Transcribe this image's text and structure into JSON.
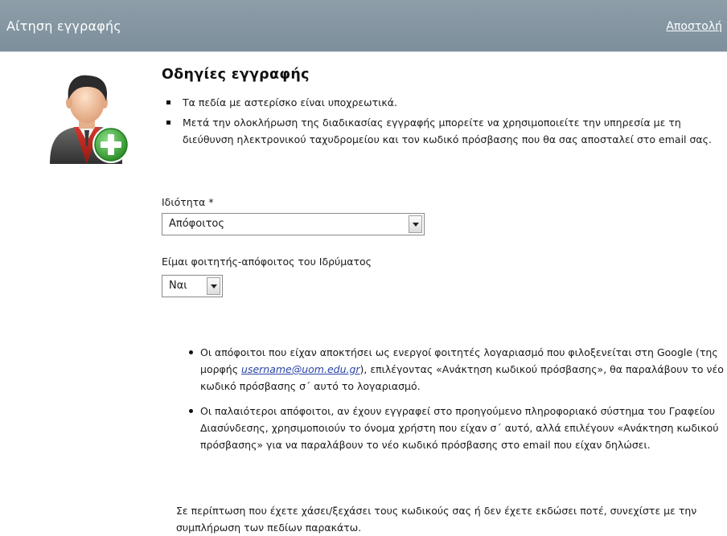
{
  "header": {
    "title": "Αίτηση εγγραφής",
    "send_label": "Αποστολή"
  },
  "avatar": {
    "icon": "user-add-icon"
  },
  "instructions": {
    "heading": "Οδηγίες εγγραφής",
    "items": [
      "Τα πεδία με αστερίσκο είναι υποχρεωτικά.",
      "Μετά την ολοκλήρωση της διαδικασίας εγγραφής μπορείτε να χρησιμοποιείτε την υπηρεσία με τη διεύθυνση ηλεκτρονικού ταχυδρομείου και τον κωδικό πρόσβασης που θα σας αποσταλεί στο email σας."
    ]
  },
  "form": {
    "property": {
      "label": "Ιδιότητα *",
      "value": "Απόφοιτος"
    },
    "student": {
      "label": "Είμαι φοιτητής-απόφοιτος του Ιδρύματος",
      "value": "Ναι"
    }
  },
  "info": {
    "bullet1_pre": "Οι απόφοιτοι που είχαν αποκτήσει ως ενεργοί φοιτητές λογαριασμό που φιλοξενείται στη Google (της μορφής ",
    "bullet1_link": "username@uom.edu.gr",
    "bullet1_post": "), επιλέγοντας «Ανάκτηση κωδικού πρόσβασης», θα παραλάβουν το νέο κωδικό πρόσβασης σ΄ αυτό το λογαριασμό.",
    "bullet2": "Οι παλαιότεροι απόφοιτοι, αν έχουν εγγραφεί στο προηγούμενο πληροφοριακό σύστημα του Γραφείου Διασύνδεσης, χρησιμοποιούν το όνομα χρήστη που είχαν σ΄ αυτό, αλλά επιλέγουν «Ανάκτηση κωδικού πρόσβασης» για να παραλάβουν το νέο κωδικό πρόσβασης στο email που είχαν δηλώσει.",
    "note": "Σε περίπτωση που έχετε χάσει/ξεχάσει τους κωδικούς σας ή δεν έχετε εκδώσει ποτέ, συνεχίστε με την συμπλήρωση των πεδίων παρακάτω."
  }
}
